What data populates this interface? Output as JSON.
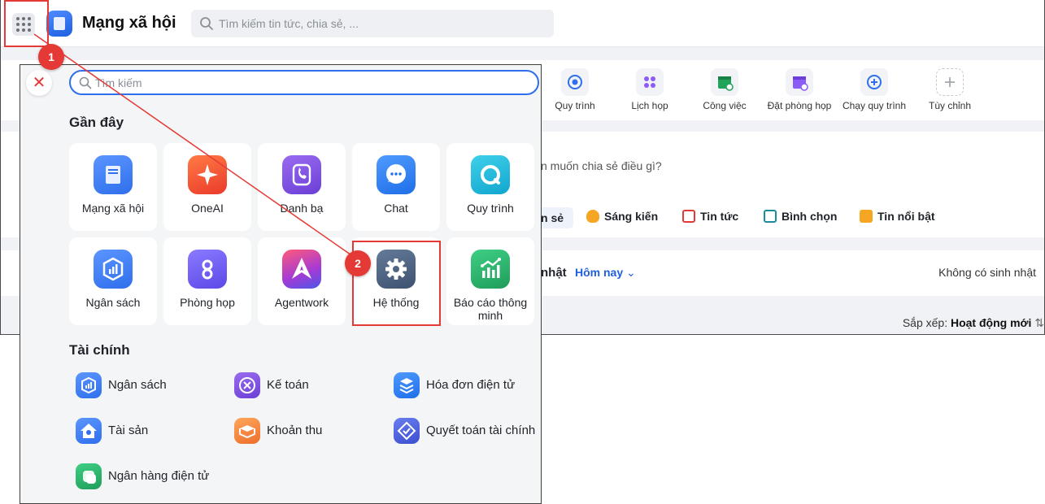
{
  "app": {
    "title": "Mạng xã hội",
    "search_placeholder": "Tìm kiếm tin tức, chia sẻ, ..."
  },
  "quick_actions": [
    {
      "label": "Quy trình",
      "icon": "process-icon",
      "color": "#2f6fec"
    },
    {
      "label": "Lịch họp",
      "icon": "meeting-icon",
      "color": "#8b5cf6"
    },
    {
      "label": "Công việc",
      "icon": "task-icon",
      "color": "#22a35a"
    },
    {
      "label": "Đặt phòng họp",
      "icon": "room-booking-icon",
      "color": "#8b5cf6"
    },
    {
      "label": "Chạy quy trình",
      "icon": "run-process-icon",
      "color": "#2f6fec"
    },
    {
      "label": "Tùy chỉnh",
      "icon": "plus-icon",
      "color": "#9aa0a6"
    }
  ],
  "composer": {
    "prompt": "n muốn chia sẻ điều gì?",
    "post_types": [
      {
        "label": "n sẻ",
        "color": "#2f6fec"
      },
      {
        "label": "Sáng kiến",
        "color": "#f5a623"
      },
      {
        "label": "Tin tức",
        "color": "#e53935"
      },
      {
        "label": "Bình chọn",
        "color": "#1a8c9c"
      },
      {
        "label": "Tin nổi bật",
        "color": "#f5a623"
      }
    ]
  },
  "birthday": {
    "label": "nhật",
    "filter": "Hôm nay",
    "empty_text": "Không có sinh nhật"
  },
  "sort": {
    "label": "Sắp xếp:",
    "value": "Hoạt động mới"
  },
  "launcher": {
    "search_placeholder": "Tìm kiếm",
    "recent_title": "Gần đây",
    "recent_apps": [
      {
        "label": "Mạng xã hội",
        "icon": "social-network-icon",
        "color": "#2f6fec"
      },
      {
        "label": "OneAI",
        "icon": "sparkle-icon",
        "color": "#f0522f"
      },
      {
        "label": "Danh bạ",
        "icon": "phone-book-icon",
        "color": "#7c4ddb"
      },
      {
        "label": "Chat",
        "icon": "chat-icon",
        "color": "#2f7bf0"
      },
      {
        "label": "Quy trình",
        "icon": "process-icon",
        "color": "#22b6d6"
      },
      {
        "label": "Ngân sách",
        "icon": "budget-icon",
        "color": "#2f6fec"
      },
      {
        "label": "Phòng họp",
        "icon": "meeting-room-icon",
        "color": "#6b5cf0"
      },
      {
        "label": "Agentwork",
        "icon": "agentwork-icon",
        "color": "#c0379a"
      },
      {
        "label": "Hệ thống",
        "icon": "gear-icon",
        "color": "#4f6480"
      },
      {
        "label": "Báo cáo thông minh",
        "icon": "smart-report-icon",
        "color": "#27a86a"
      }
    ],
    "finance_title": "Tài chính",
    "finance_apps": [
      {
        "label": "Ngân sách",
        "icon": "budget-icon",
        "color": "#2f6fec"
      },
      {
        "label": "Kế toán",
        "icon": "accounting-icon",
        "color": "#7c4ddb"
      },
      {
        "label": "Hóa đơn điện tử",
        "icon": "e-invoice-icon",
        "color": "#2f7bf0"
      },
      {
        "label": "Tài sản",
        "icon": "asset-icon",
        "color": "#2f6fec"
      },
      {
        "label": "Khoản thu",
        "icon": "revenue-icon",
        "color": "#f08a3c"
      },
      {
        "label": "Quyết toán tài chính",
        "icon": "settlement-icon",
        "color": "#4a5fd8"
      },
      {
        "label": "Ngân hàng điện tử",
        "icon": "e-banking-icon",
        "color": "#27a86a"
      }
    ]
  },
  "annotations": {
    "step1": "1",
    "step2": "2",
    "color": "#e53935"
  }
}
